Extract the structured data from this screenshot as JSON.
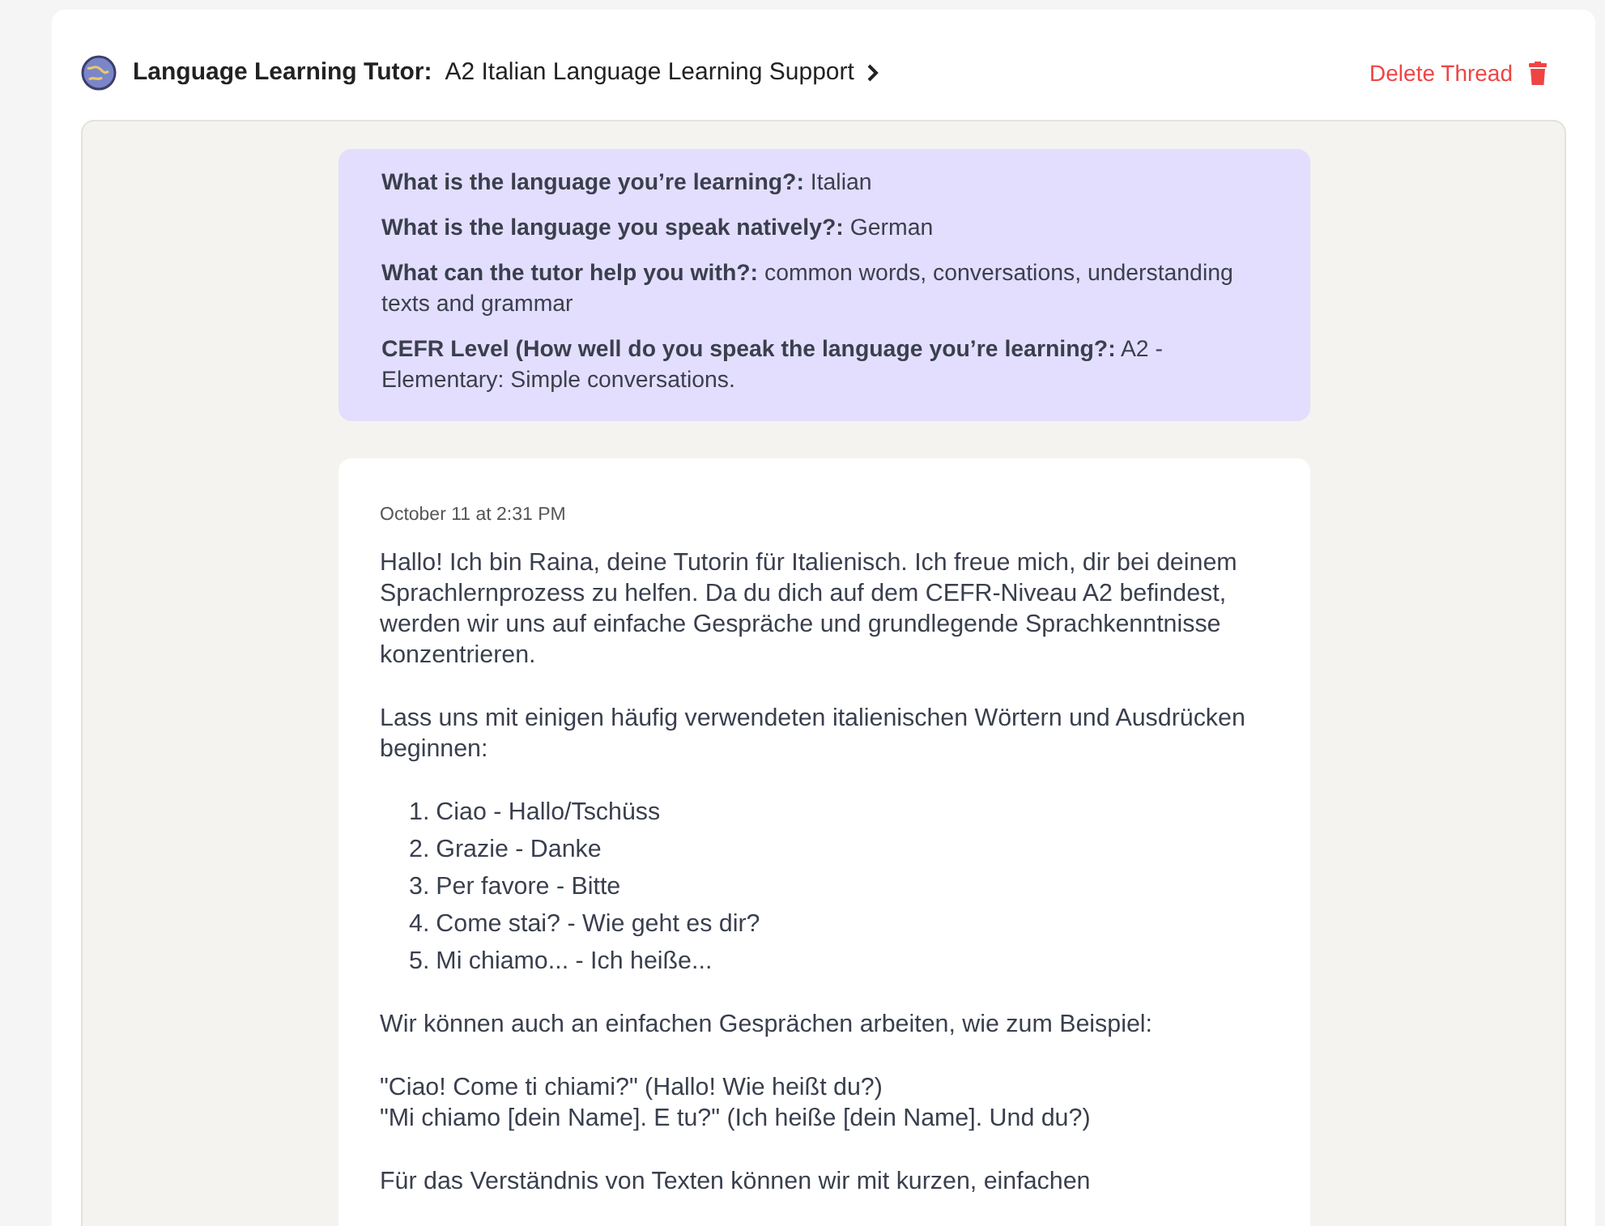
{
  "header": {
    "tutor_label": "Language Learning Tutor:",
    "thread_title": "A2 Italian Language Learning Support",
    "delete_label": "Delete Thread"
  },
  "setup": [
    {
      "question": "What is the language you’re learning?:",
      "answer": "Italian"
    },
    {
      "question": "What is the language you speak natively?:",
      "answer": "German"
    },
    {
      "question": "What can the tutor help you with?:",
      "answer": "common words, conversations, understanding texts and grammar"
    },
    {
      "question": "CEFR Level (How well do you speak the language you’re learning?:",
      "answer": "A2 - Elementary: Simple conversations."
    }
  ],
  "message": {
    "timestamp": "October 11 at 2:31 PM",
    "blocks": [
      {
        "kind": "paragraph",
        "text": "Hallo! Ich bin Raina, deine Tutorin für Italienisch. Ich freue mich, dir bei deinem Sprachlernprozess zu helfen. Da du dich auf dem CEFR-Niveau A2 befindest, werden wir uns auf einfache Gespräche und grundlegende Sprachkenntnisse konzentrieren."
      },
      {
        "kind": "paragraph",
        "text": "Lass uns mit einigen häufig verwendeten italienischen Wörtern und Ausdrücken beginnen:"
      },
      {
        "kind": "list",
        "items": [
          {
            "number": "1.",
            "text": "Ciao - Hallo/Tschüss"
          },
          {
            "number": "2.",
            "text": "Grazie - Danke"
          },
          {
            "number": "3.",
            "text": "Per favore - Bitte"
          },
          {
            "number": "4.",
            "text": "Come stai? - Wie geht es dir?"
          },
          {
            "number": "5.",
            "text": "Mi chiamo... - Ich heiße..."
          }
        ]
      },
      {
        "kind": "paragraph",
        "text": "Wir können auch an einfachen Gesprächen arbeiten, wie zum Beispiel:"
      },
      {
        "kind": "lines",
        "items": [
          "\"Ciao! Come ti chiami?\" (Hallo! Wie heißt du?)",
          "\"Mi chiamo [dein Name]. E tu?\" (Ich heiße [dein Name]. Und du?)"
        ]
      },
      {
        "kind": "paragraph",
        "text": "Für das Verständnis von Texten können wir mit kurzen, einfachen"
      }
    ]
  }
}
